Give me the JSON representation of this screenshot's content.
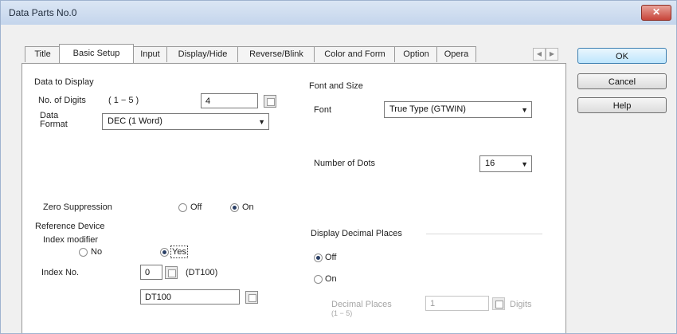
{
  "window": {
    "title": "Data Parts No.0",
    "close_glyph": "✕"
  },
  "tabs": [
    {
      "label": "Title"
    },
    {
      "label": "Basic Setup",
      "active": true
    },
    {
      "label": "Input"
    },
    {
      "label": "Display/Hide"
    },
    {
      "label": "Reverse/Blink"
    },
    {
      "label": "Color and Form"
    },
    {
      "label": "Option"
    },
    {
      "label": "Opera"
    }
  ],
  "tab_scroll": {
    "left_glyph": "◀",
    "right_glyph": "▶"
  },
  "data_display": {
    "heading": "Data to Display",
    "digits_label": "No. of Digits",
    "digits_range": "( 1 − 5 )",
    "digits_value": "4",
    "format_label": "Data\nFormat",
    "format_value": "DEC (1 Word)"
  },
  "font_size": {
    "heading": "Font and Size",
    "font_label": "Font",
    "font_value": "True Type (GTWIN)",
    "dots_label": "Number of Dots",
    "dots_value": "16"
  },
  "zero_suppression": {
    "label": "Zero Suppression",
    "options": [
      {
        "label": "Off",
        "selected": false
      },
      {
        "label": "On",
        "selected": true
      }
    ]
  },
  "reference_device": {
    "heading": "Reference Device",
    "index_modifier_label": "Index modifier",
    "options": [
      {
        "label": "No",
        "selected": false
      },
      {
        "label": "Yes",
        "selected": true
      }
    ],
    "index_no_label": "Index No.",
    "index_no_value": "0",
    "index_no_device": "(DT100)",
    "device_value": "DT100"
  },
  "decimal_places": {
    "heading": "Display Decimal Places",
    "options": [
      {
        "label": "Off",
        "selected": true
      },
      {
        "label": "On",
        "selected": false
      }
    ],
    "places_label": "Decimal Places",
    "places_range": "(1 − 5)",
    "places_value": "1",
    "digits_suffix": "Digits"
  },
  "buttons": {
    "ok": "OK",
    "cancel": "Cancel",
    "help": "Help"
  },
  "colors": {
    "titlebar": "#c4d5ec",
    "close": "#c8453a",
    "default_button": "#bee6fd"
  }
}
